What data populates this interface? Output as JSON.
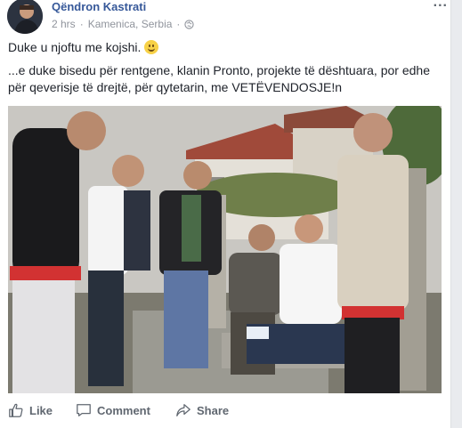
{
  "post": {
    "author": "Qëndron Kastrati",
    "time": "2 hrs",
    "separator": "·",
    "location": "Kamenica, Serbia",
    "audience_icon": "globe-icon",
    "menu_label": "...",
    "line1": "Duke u njoftu me kojshi.",
    "line2": "...e duke bisedu për rentgene, klanin Pronto, projekte të dështuara, por edhe për qeverisje të drejtë, për qytetarin, me VETËVENDOSJE!n"
  },
  "actions": {
    "like": "Like",
    "comment": "Comment",
    "share": "Share"
  },
  "colors": {
    "author_link": "#365899",
    "action_text": "#606770",
    "page_bg": "#e9ebee"
  }
}
